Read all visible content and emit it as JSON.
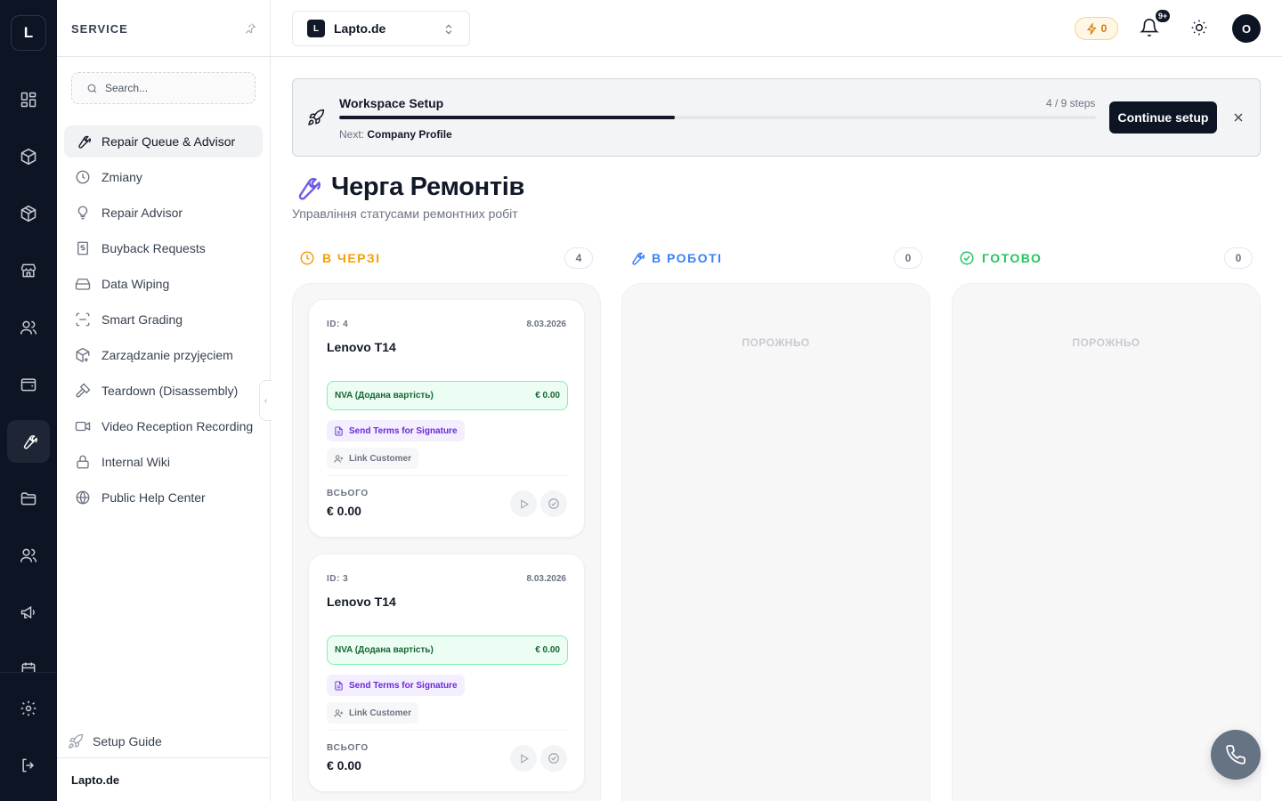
{
  "rail": {
    "logo": "L"
  },
  "sidebar": {
    "title": "SERVICE",
    "search_placeholder": "Search...",
    "items": [
      {
        "label": "Repair Queue & Advisor"
      },
      {
        "label": "Zmiany"
      },
      {
        "label": "Repair Advisor"
      },
      {
        "label": "Buyback Requests"
      },
      {
        "label": "Data Wiping"
      },
      {
        "label": "Smart Grading"
      },
      {
        "label": "Zarządzanie przyjęciem"
      },
      {
        "label": "Teardown (Disassembly)"
      },
      {
        "label": "Video Reception Recording"
      },
      {
        "label": "Internal Wiki"
      },
      {
        "label": "Public Help Center"
      }
    ],
    "setup_guide": "Setup Guide",
    "footer": "Lapto.de"
  },
  "topbar": {
    "workspace_badge": "L",
    "workspace": "Lapto.de",
    "energy": "0",
    "notifications_badge": "9+",
    "avatar": "O"
  },
  "banner": {
    "title": "Workspace Setup",
    "steps": "4 / 9 steps",
    "progress_fraction": 0.444,
    "next_label": "Next:",
    "next_value": "Company Profile",
    "continue": "Continue setup"
  },
  "page": {
    "title": "Черга Ремонтів",
    "subtitle": "Управління статусами ремонтних робіт"
  },
  "columns": [
    {
      "label": "В ЧЕРЗІ",
      "count": "4",
      "color": "#f59e0b"
    },
    {
      "label": "В РОБОТІ",
      "count": "0",
      "color": "#3b82f6",
      "empty": "ПОРОЖНЬО"
    },
    {
      "label": "ГОТОВО",
      "count": "0",
      "color": "#22c55e",
      "empty": "ПОРОЖНЬО"
    }
  ],
  "cards": [
    {
      "id": "ID: 4",
      "date": "8.03.2026",
      "title": "Lenovo T14",
      "nva_label": "NVA (Додана вартість)",
      "nva_value": "€  0.00",
      "terms": "Send Terms for Signature",
      "link": "Link Customer",
      "total_label": "ВСЬОГО",
      "total": "€  0.00"
    },
    {
      "id": "ID: 3",
      "date": "8.03.2026",
      "title": "Lenovo T14",
      "nva_label": "NVA (Додана вартість)",
      "nva_value": "€  0.00",
      "terms": "Send Terms for Signature",
      "link": "Link Customer",
      "total_label": "ВСЬОГО",
      "total": "€  0.00"
    }
  ]
}
